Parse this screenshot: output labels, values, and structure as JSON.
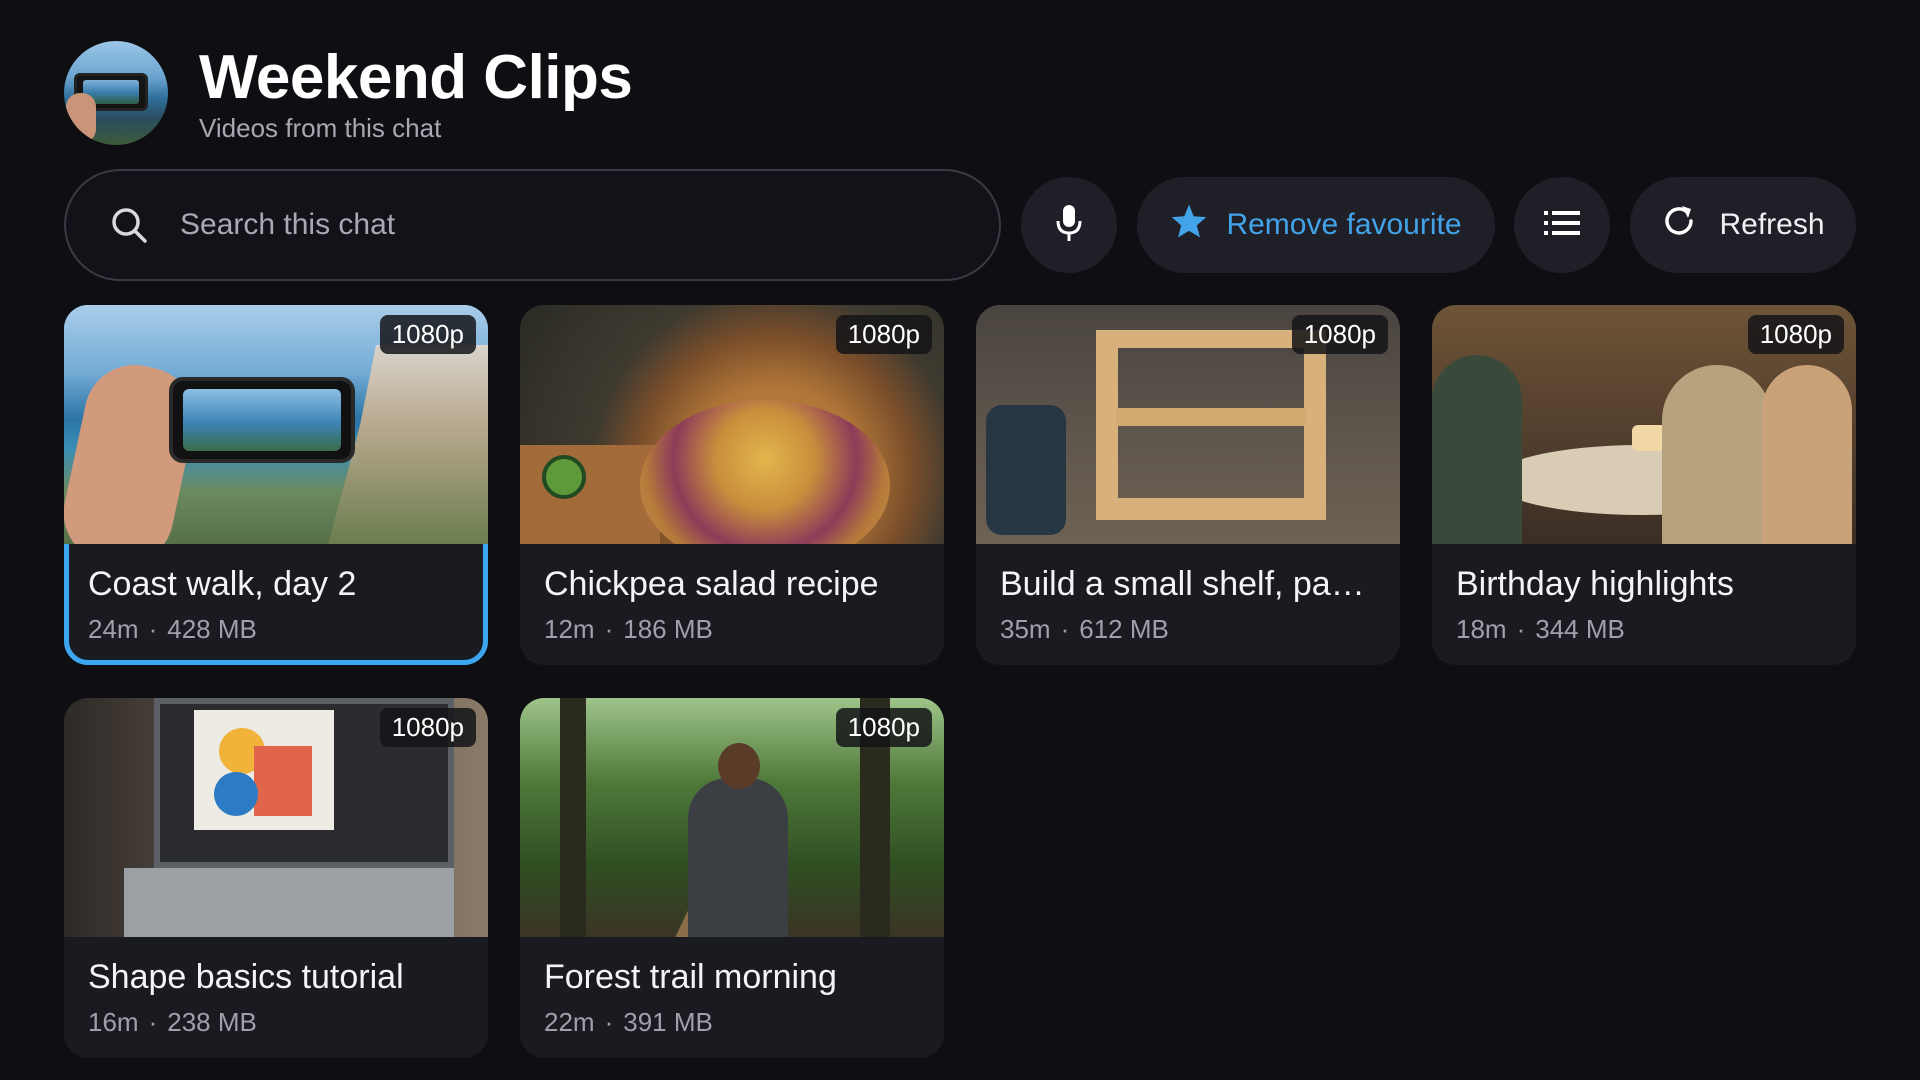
{
  "header": {
    "title": "Weekend Clips",
    "subtitle": "Videos from this chat"
  },
  "search": {
    "placeholder": "Search this chat",
    "value": ""
  },
  "toolbar": {
    "favourite_label": "Remove favourite",
    "refresh_label": "Refresh",
    "accent_color": "#42a3e8"
  },
  "videos": [
    {
      "title": "Coast walk, day 2",
      "duration": "24m",
      "size": "428 MB",
      "quality": "1080p",
      "selected": true
    },
    {
      "title": "Chickpea salad recipe",
      "duration": "12m",
      "size": "186 MB",
      "quality": "1080p",
      "selected": false
    },
    {
      "title": "Build a small shelf, par…",
      "duration": "35m",
      "size": "612 MB",
      "quality": "1080p",
      "selected": false
    },
    {
      "title": "Birthday highlights",
      "duration": "18m",
      "size": "344 MB",
      "quality": "1080p",
      "selected": false
    },
    {
      "title": "Shape basics tutorial",
      "duration": "16m",
      "size": "238 MB",
      "quality": "1080p",
      "selected": false
    },
    {
      "title": "Forest trail morning",
      "duration": "22m",
      "size": "391 MB",
      "quality": "1080p",
      "selected": false
    }
  ],
  "meta_separator": "·",
  "icons": {
    "search": "search-icon",
    "mic": "microphone-icon",
    "favourite": "star-icon",
    "list": "list-view-icon",
    "refresh": "refresh-icon"
  }
}
